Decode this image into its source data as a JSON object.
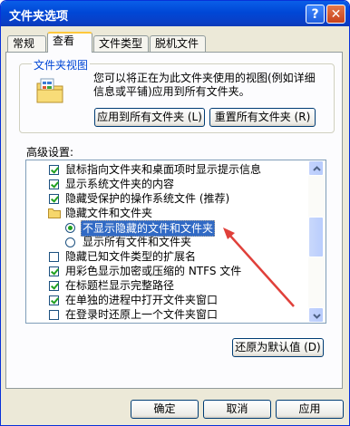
{
  "window": {
    "title": "文件夹选项",
    "help_glyph": "?",
    "close_glyph": "✕"
  },
  "tabs": [
    {
      "label": "常规"
    },
    {
      "label": "查看",
      "active": true
    },
    {
      "label": "文件类型"
    },
    {
      "label": "脱机文件"
    }
  ],
  "folder_views": {
    "group_label": "文件夹视图",
    "icon": "folder-views-icon",
    "description_line1": "您可以将正在为此文件夹使用的视图(例如详细",
    "description_line2": "信息或平铺)应用到所有文件夹。",
    "apply_all_button": "应用到所有文件夹 (L)",
    "reset_all_button": "重置所有文件夹 (R)"
  },
  "advanced": {
    "label": "高级设置:",
    "items": [
      {
        "type": "checkbox",
        "label": "鼠标指向文件夹和桌面项时显示提示信息",
        "checked": true
      },
      {
        "type": "checkbox",
        "label": "显示系统文件夹的内容",
        "checked": true
      },
      {
        "type": "checkbox",
        "label": "隐藏受保护的操作系统文件 (推荐)",
        "checked": true
      },
      {
        "type": "folder",
        "label": "隐藏文件和文件夹",
        "icon": "folder-icon"
      },
      {
        "type": "radio",
        "label": "不显示隐藏的文件和文件夹",
        "checked": true,
        "selected": true
      },
      {
        "type": "radio",
        "label": "显示所有文件和文件夹",
        "checked": false
      },
      {
        "type": "checkbox",
        "label": "隐藏已知文件类型的扩展名",
        "checked": false
      },
      {
        "type": "checkbox",
        "label": "用彩色显示加密或压缩的 NTFS 文件",
        "checked": true
      },
      {
        "type": "checkbox",
        "label": "在标题栏显示完整路径",
        "checked": true
      },
      {
        "type": "checkbox",
        "label": "在单独的进程中打开文件夹窗口",
        "checked": true
      },
      {
        "type": "checkbox",
        "label": "在登录时还原上一个文件夹窗口",
        "checked": false
      }
    ],
    "restore_defaults_button": "还原为默认值 (D)"
  },
  "footer": {
    "ok_button": "确定",
    "cancel_button": "取消",
    "apply_button": "应用"
  },
  "colors": {
    "title_bar": "#0a5fe8",
    "selection": "#316ac5",
    "annotation_arrow": "#e0403a",
    "check_green": "#21a121"
  }
}
